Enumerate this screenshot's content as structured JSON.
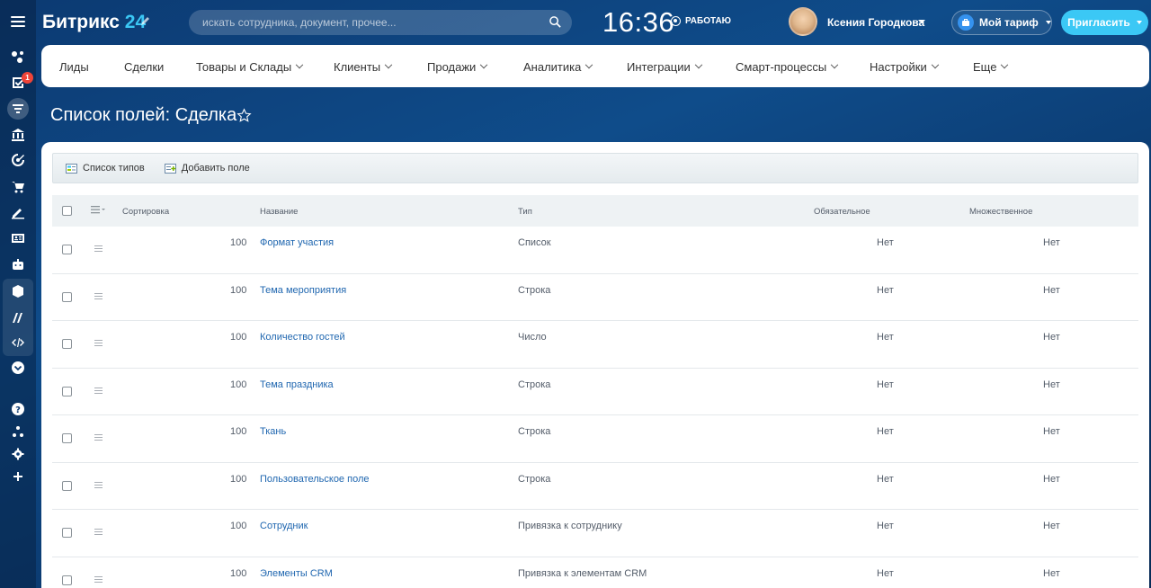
{
  "header": {
    "logo_text": "Битрикс",
    "logo_num": "24",
    "search_placeholder": "искать сотрудника, документ, прочее...",
    "clock": "16:36",
    "work_status": "РАБОТАЮ",
    "user_name": "Ксения Городкова",
    "tariff_label": "Мой тариф",
    "invite_label": "Пригласить"
  },
  "rail": {
    "badge_count": "1"
  },
  "menu": {
    "items": [
      {
        "label": "Лиды",
        "has_chevron": false
      },
      {
        "label": "Сделки",
        "has_chevron": false
      },
      {
        "label": "Товары и Склады",
        "has_chevron": true
      },
      {
        "label": "Клиенты",
        "has_chevron": true
      },
      {
        "label": "Продажи",
        "has_chevron": true
      },
      {
        "label": "Аналитика",
        "has_chevron": true
      },
      {
        "label": "Интеграции",
        "has_chevron": true
      },
      {
        "label": "Смарт-процессы",
        "has_chevron": true
      },
      {
        "label": "Настройки",
        "has_chevron": true
      },
      {
        "label": "Еще",
        "has_chevron": true
      }
    ]
  },
  "page": {
    "title": "Список полей: Сделка"
  },
  "toolbar": {
    "types_list": "Список типов",
    "add_field": "Добавить поле"
  },
  "grid": {
    "columns": {
      "sort": "Сортировка",
      "name": "Название",
      "type": "Тип",
      "required": "Обязательное",
      "multiple": "Множественное"
    },
    "rows": [
      {
        "sort": "100",
        "name": "Формат участия",
        "type": "Список",
        "required": "Нет",
        "multiple": "Нет"
      },
      {
        "sort": "100",
        "name": "Тема мероприятия",
        "type": "Строка",
        "required": "Нет",
        "multiple": "Нет"
      },
      {
        "sort": "100",
        "name": "Количество гостей",
        "type": "Число",
        "required": "Нет",
        "multiple": "Нет"
      },
      {
        "sort": "100",
        "name": "Тема праздника",
        "type": "Строка",
        "required": "Нет",
        "multiple": "Нет"
      },
      {
        "sort": "100",
        "name": "Ткань",
        "type": "Строка",
        "required": "Нет",
        "multiple": "Нет"
      },
      {
        "sort": "100",
        "name": "Пользовательское поле",
        "type": "Строка",
        "required": "Нет",
        "multiple": "Нет"
      },
      {
        "sort": "100",
        "name": "Сотрудник",
        "type": "Привязка к сотруднику",
        "required": "Нет",
        "multiple": "Нет"
      },
      {
        "sort": "100",
        "name": "Элементы CRM",
        "type": "Привязка к элементам CRM",
        "required": "Нет",
        "multiple": "Нет"
      }
    ]
  },
  "colors": {
    "accent": "#3bc8f5",
    "link": "#2067b0",
    "badge": "#f04438"
  }
}
